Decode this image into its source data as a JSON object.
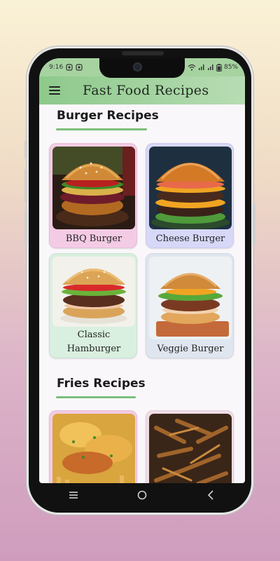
{
  "status": {
    "time": "9:16",
    "battery": "85%"
  },
  "appbar": {
    "title": "Fast Food Recipes"
  },
  "sections": [
    {
      "title": "Burger Recipes"
    },
    {
      "title": "Fries Recipes"
    }
  ],
  "burgers": [
    {
      "label": "BBQ Burger",
      "color": "#f3cbe4"
    },
    {
      "label": "Cheese Burger",
      "color": "#d7d8f8"
    },
    {
      "label_line1": "Classic",
      "label_line2": "Hamburger",
      "color": "#d9efdf"
    },
    {
      "label": "Veggie Burger",
      "color": "#dfe6f0"
    }
  ],
  "fries": [
    {
      "color": "#f3cbe4"
    },
    {
      "color": "#f0dde4"
    }
  ],
  "colors": {
    "accent": "#8dc98b",
    "underline": "#7bbf7a"
  },
  "icons": [
    "menu-icon",
    "camera-icon",
    "wifi-icon",
    "signal-icon",
    "battery-icon",
    "recent-apps-icon",
    "home-icon",
    "back-icon"
  ]
}
